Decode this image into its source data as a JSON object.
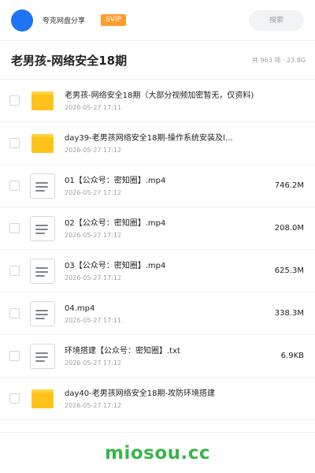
{
  "header": {
    "app_name": "夸克网盘分享",
    "badge": "SVIP",
    "search_placeholder": "搜索",
    "avatar_color": "#1e74f5",
    "badge_color": "#ff9d2e"
  },
  "title_row": {
    "title": "老男孩-网络安全18期",
    "summary": "共 963 项 · 23.8G"
  },
  "files": [
    {
      "name": "老男孩-网络安全18期（大部分视频加密暂无，仅资料)",
      "date": "2026-05-27 17:11",
      "size": "",
      "icon": "folder-icon"
    },
    {
      "name": "day39-老男孩网络安全18期-操作系统安装及l…",
      "date": "2026-05-27 17:12",
      "size": "",
      "icon": "folder-icon"
    },
    {
      "name": "01【公众号：密知圈】.mp4",
      "date": "2026-05-27 17:12",
      "size": "746.2M",
      "icon": "document-icon"
    },
    {
      "name": "02【公众号：密知圈】.mp4",
      "date": "2026-05-27 17:12",
      "size": "208.0M",
      "icon": "document-icon"
    },
    {
      "name": "03【公众号：密知圈】.mp4",
      "date": "2026-05-27 17:12",
      "size": "625.3M",
      "icon": "document-icon"
    },
    {
      "name": "04.mp4",
      "date": "2026-05-27 17:11",
      "size": "338.3M",
      "icon": "document-icon"
    },
    {
      "name": "环境搭建【公众号：密知圈】.txt",
      "date": "2026-05-27 17:12",
      "size": "6.9KB",
      "icon": "document-icon"
    },
    {
      "name": "day40-老男孩网络安全18期-攻防环境搭建",
      "date": "2026-05-27 17:12",
      "size": "",
      "icon": "folder-icon"
    }
  ],
  "footer": {
    "brand": "miosou.cc",
    "brand_color": "#3ab54a"
  }
}
